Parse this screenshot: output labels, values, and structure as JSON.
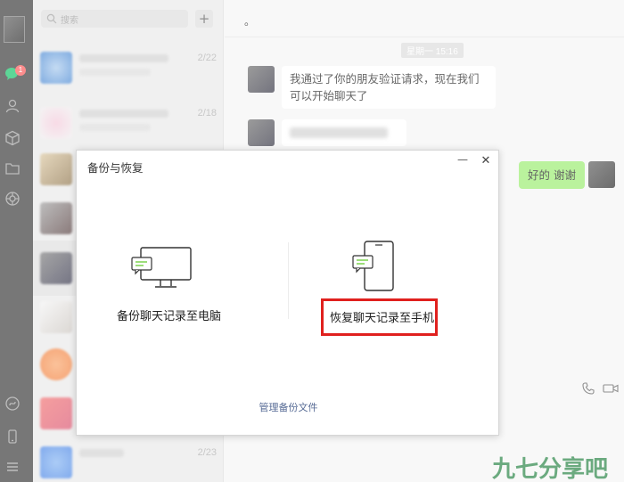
{
  "sidebar": {
    "badge_count": "1"
  },
  "search": {
    "placeholder": "搜索",
    "add_label": "+"
  },
  "sessions": [
    {
      "date": "2/22"
    },
    {
      "date": "2/18"
    },
    {
      "date": ""
    },
    {
      "date": ""
    },
    {
      "date": ""
    },
    {
      "date": ""
    },
    {
      "date": ""
    },
    {
      "date": ""
    },
    {
      "date": "2/23"
    }
  ],
  "chat": {
    "title": "。",
    "time_chip": "星期一 15:16",
    "incoming_message": "我通过了你的朋友验证请求，现在我们可以开始聊天了",
    "outgoing_message": "好的 谢谢"
  },
  "dialog": {
    "title": "备份与恢复",
    "minimize_label": "—",
    "close_label": "✕",
    "backup_label": "备份聊天记录至电脑",
    "restore_label": "恢复聊天记录至手机",
    "manage_label": "管理备份文件"
  },
  "watermark": {
    "text": "九七分享吧"
  },
  "colors": {
    "accent_green": "#95ec69",
    "highlight_red": "#e0201e",
    "link_blue": "#576b95"
  }
}
